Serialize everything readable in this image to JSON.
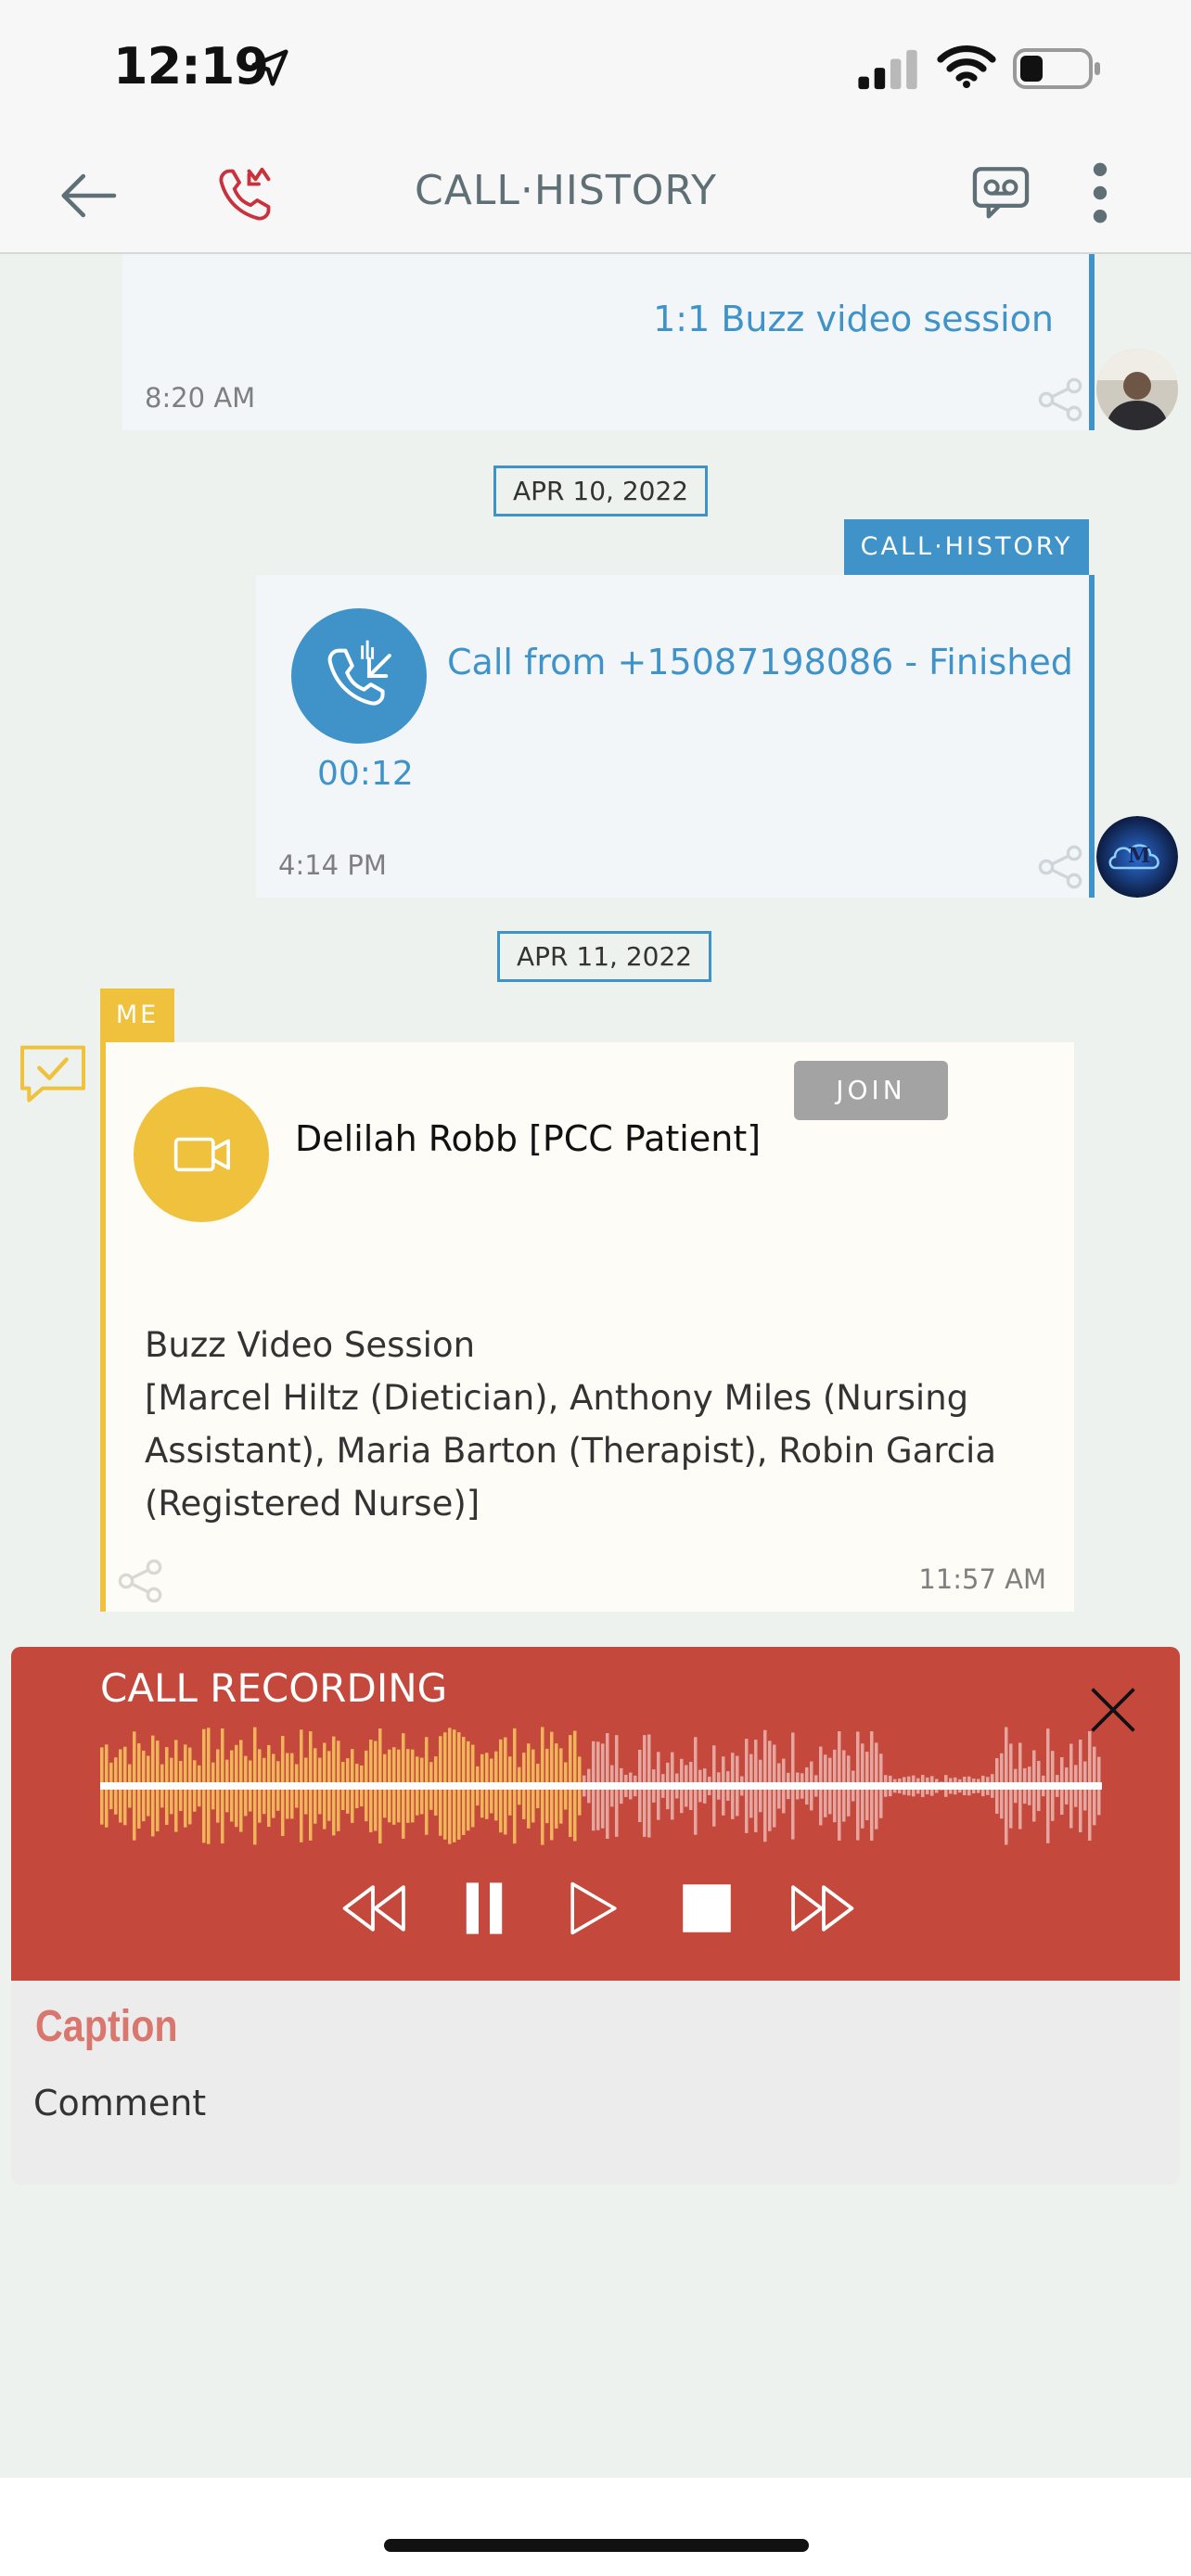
{
  "status_bar": {
    "time": "12:19"
  },
  "header": {
    "title": "CALL·HISTORY",
    "icons": [
      "back-arrow-icon",
      "missed-call-icon",
      "voicemail-icon",
      "more-vertical-icon"
    ]
  },
  "messages": [
    {
      "type": "session",
      "text": "1:1 Buzz video session",
      "time": "8:20 AM"
    },
    {
      "type": "date",
      "label": "APR 10, 2022"
    },
    {
      "type": "call",
      "tag": "CALL·HISTORY",
      "text": "Call from +15087198086 - Finished",
      "duration": "00:12",
      "time": "4:14 PM",
      "avatar_initial": "M"
    },
    {
      "type": "date",
      "label": "APR 11, 2022"
    },
    {
      "type": "video_invite",
      "tag": "ME",
      "join_label": "JOIN",
      "name": "Delilah Robb [PCC Patient]",
      "body_line1": "Buzz Video Session",
      "body_line2": "[Marcel Hiltz (Dietician), Anthony Miles (Nursing",
      "body_line3": "Assistant), Maria Barton (Therapist), Robin Garcia",
      "body_line4": "(Registered Nurse)]",
      "time": "11:57 AM"
    }
  ],
  "recorder": {
    "title": "CALL RECORDING",
    "progress": 0.48,
    "controls": [
      "rewind-icon",
      "pause-icon",
      "play-icon",
      "stop-icon",
      "fast-forward-icon"
    ]
  },
  "caption": {
    "label": "Caption",
    "placeholder": "Comment"
  },
  "colors": {
    "accent_blue": "#3f93c9",
    "accent_yellow": "#efc13d",
    "recorder_red": "#c4493c",
    "missed_red": "#c8323c"
  }
}
